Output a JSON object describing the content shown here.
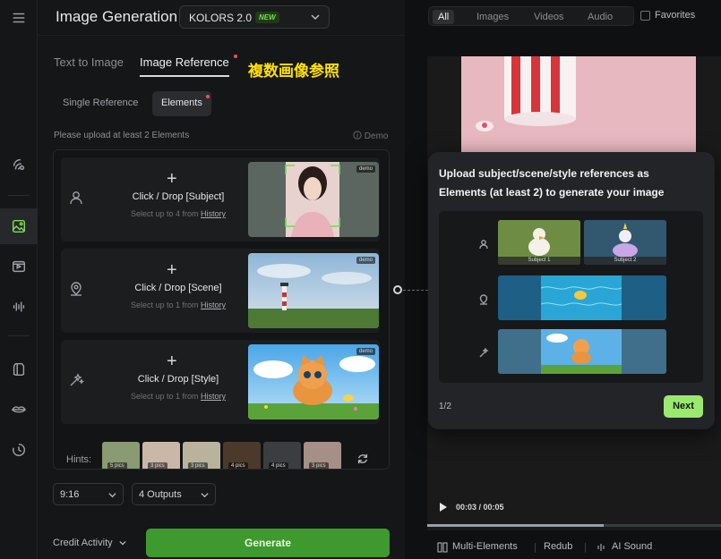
{
  "app": {
    "title": "Image Generation",
    "model": {
      "name": "KOLORS 2.0",
      "badge": "NEW"
    }
  },
  "tabs": [
    {
      "label": "Text to Image",
      "active": false
    },
    {
      "label": "Image Reference",
      "active": true
    }
  ],
  "annotation": "複数画像参照",
  "subtabs": [
    {
      "label": "Single Reference",
      "active": false
    },
    {
      "label": "Elements",
      "active": true
    }
  ],
  "upload_note": "Please upload at least 2 Elements",
  "demo_link": "Demo",
  "elements": [
    {
      "type": "subject",
      "click_label": "Click / Drop [Subject]",
      "hint_prefix": "Select up to 4 from",
      "hint_link": "History",
      "thumb_tag": "demo"
    },
    {
      "type": "scene",
      "click_label": "Click / Drop [Scene]",
      "hint_prefix": "Select up to 1 from",
      "hint_link": "History",
      "thumb_tag": "demo"
    },
    {
      "type": "style",
      "click_label": "Click / Drop [Style]",
      "hint_prefix": "Select up to 1 from",
      "hint_link": "History",
      "thumb_tag": "demo"
    }
  ],
  "hints": {
    "label": "Hints:",
    "counts": [
      "5 pics",
      "3 pics",
      "3 pics",
      "4 pics",
      "4 pics",
      "3 pics"
    ]
  },
  "options": {
    "aspect_ratio": "9:16",
    "outputs": "4 Outputs"
  },
  "footer": {
    "credit_label": "Credit Activity",
    "generate_label": "Generate"
  },
  "filters": {
    "items": [
      "All",
      "Images",
      "Videos",
      "Audio"
    ],
    "active": "All",
    "favorites_label": "Favorites"
  },
  "player": {
    "time": "00:03 / 00:05",
    "progress": 0.6
  },
  "bottom_tools": [
    "Multi-Elements",
    "Redub",
    "AI Sound"
  ],
  "popover": {
    "title": "Upload subject/scene/style references as Elements (at least 2) to generate your image",
    "demo_labels": {
      "subject1": "Subject 1",
      "subject2": "Subject 2"
    },
    "pager": "1/2",
    "next_label": "Next"
  },
  "colors": {
    "accent_green": "#3e9a2e",
    "next_green": "#9be86f",
    "annotation_yellow": "#ffe100",
    "badge_red": "#ff4d4f"
  }
}
